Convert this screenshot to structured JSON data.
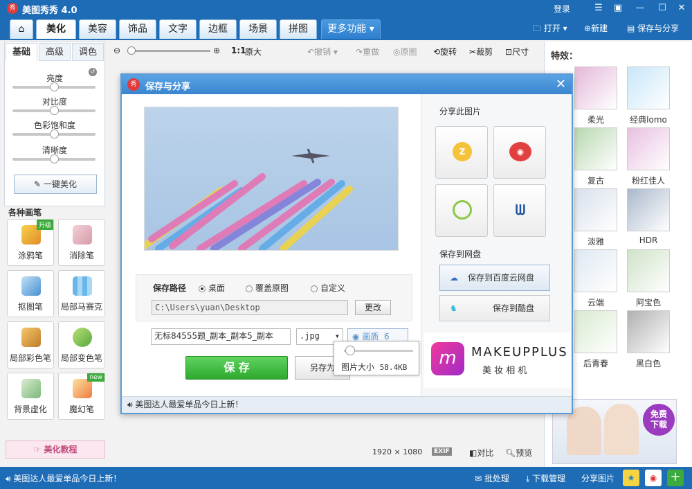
{
  "app": {
    "title": "美图秀秀 4.0",
    "logo_text": "秀",
    "login": "登录"
  },
  "nav": {
    "tabs": [
      {
        "label": "美化"
      },
      {
        "label": "美容"
      },
      {
        "label": "饰品"
      },
      {
        "label": "文字"
      },
      {
        "label": "边框"
      },
      {
        "label": "场景"
      },
      {
        "label": "拼图"
      },
      {
        "label": "更多功能"
      }
    ],
    "open": "打开",
    "new": "新建",
    "save_share": "保存与分享"
  },
  "left": {
    "subtabs": [
      "基础",
      "高级",
      "调色"
    ],
    "sliders": [
      {
        "label": "亮度",
        "level": 0.5
      },
      {
        "label": "对比度",
        "level": 0.5
      },
      {
        "label": "色彩饱和度",
        "level": 0.5
      },
      {
        "label": "清晰度",
        "level": 0.5
      }
    ],
    "one_key": "一键美化",
    "brushes_title": "各种画笔",
    "tools": [
      {
        "label": "涂鸦笔",
        "badge": "升级"
      },
      {
        "label": "消除笔",
        "badge": ""
      },
      {
        "label": "抠图笔",
        "badge": ""
      },
      {
        "label": "局部马赛克",
        "badge": ""
      },
      {
        "label": "局部彩色笔",
        "badge": ""
      },
      {
        "label": "局部变色笔",
        "badge": ""
      },
      {
        "label": "背景虚化",
        "badge": ""
      },
      {
        "label": "魔幻笔",
        "badge": "new"
      }
    ],
    "tutorial": "美化教程"
  },
  "toolbar": {
    "ratio": "1:1",
    "original_size": "原大",
    "undo": "撤销",
    "redo": "重做",
    "original": "原图",
    "rotate": "旋转",
    "crop": "裁剪",
    "resize": "尺寸"
  },
  "effects": {
    "title": "特效：",
    "items": [
      "柔光",
      "经典lomo",
      "复古",
      "粉红佳人",
      "淡雅",
      "HDR",
      "云端",
      "阿宝色",
      "后青春",
      "黑白色"
    ],
    "colors": [
      "#e4b8d8",
      "#c8e6f8",
      "#b8d8b0",
      "#e8c0e0",
      "#d8e0ec",
      "#aab8cc",
      "#dfe8f2",
      "#d0e2c8",
      "#d8ead0",
      "#b0b0b0"
    ],
    "ad_button": "免费\n下载"
  },
  "dialog": {
    "title": "保存与分享",
    "logo_text": "秀",
    "path_label": "保存路径",
    "options": [
      "桌面",
      "覆盖原图",
      "自定义"
    ],
    "path": "C:\\Users\\yuan\\Desktop",
    "change": "更改",
    "filename": "无标84555题_副本_副本5_副本",
    "ext": ".jpg",
    "quality_label": "画质",
    "quality_value": "6",
    "save": "保 存",
    "save_as": "另存为",
    "size_label": "图片大小",
    "size_value": "58.4KB",
    "share_title": "分享此图片",
    "cloud_title": "保存到网盘",
    "baidu": "保存到百度云网盘",
    "kuaipan": "保存到酷盘",
    "ad_brand": "MAKEUPPLUS",
    "ad_sub": "美 妆 相 机",
    "status": "美图达人最爱单品今日上新！"
  },
  "canvas": {
    "width": "1920",
    "times": "×",
    "height": "1080",
    "exif": "EXIF",
    "compare": "对比",
    "preview": "预览"
  },
  "status": {
    "text": "美图达人最爱单品今日上新！",
    "batch": "批处理",
    "download": "下载管理",
    "share": "分享图片"
  }
}
